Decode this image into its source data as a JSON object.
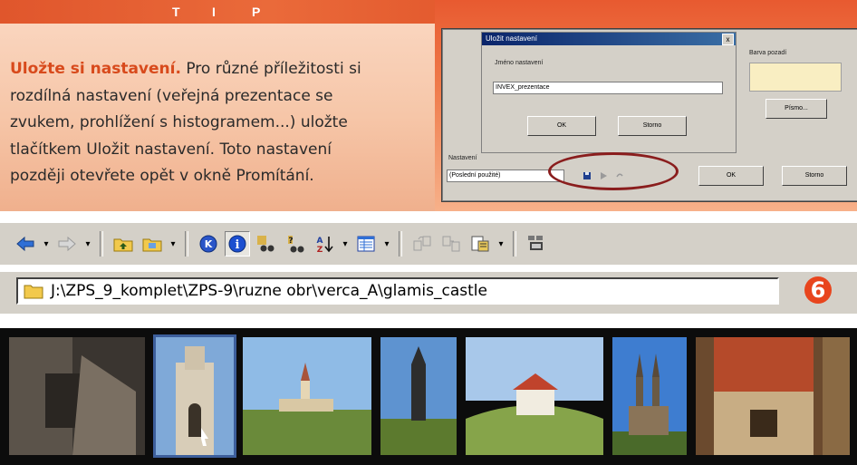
{
  "tip": {
    "heading": [
      "T",
      "I",
      "P"
    ],
    "lead": "Uložte si nastavení.",
    "body_lines": [
      " Pro různé příležitosti si",
      "rozdílná nastavení (veřejná prezentace se",
      "zvukem, prohlížení s histogramem...) uložte",
      "tlačítkem Uložit nastavení. Toto nastavení",
      "později otevřete opět v okně Promítání."
    ]
  },
  "dialog": {
    "title": "Uložit nastavení",
    "close": "x",
    "name_label": "Jméno nastavení",
    "name_value": "INVEX_prezentace",
    "ok": "OK",
    "cancel": "Storno",
    "right_label": "Barva pozadí",
    "font_button": "Písmo...",
    "bottom_label": "Nastavení",
    "bottom_value": "(Poslední použité)",
    "bottom_ok": "OK",
    "bottom_cancel": "Storno"
  },
  "toolbar": {
    "buttons": [
      "back-arrow-icon",
      "forward-arrow-icon",
      "folder-up-icon",
      "folder-browse-icon",
      "k-circle-icon",
      "info-circle-icon",
      "binoculars-icon",
      "find-key-icon",
      "sort-az-icon",
      "view-details-icon",
      "copy-to-icon",
      "move-to-icon",
      "properties-icon",
      "slideshow-icon"
    ]
  },
  "address": {
    "path": "J:\\ZPS_9_komplet\\ZPS-9\\ruzne obr\\verca_A\\glamis_castle"
  },
  "badge": "6",
  "thumbnails": [
    {
      "name": "old-stone-wall"
    },
    {
      "name": "castle-tower-selected"
    },
    {
      "name": "church-landscape"
    },
    {
      "name": "monument-tower"
    },
    {
      "name": "chapel-on-hill"
    },
    {
      "name": "cathedral-spires"
    },
    {
      "name": "rooftop-view"
    }
  ],
  "colors": {
    "accent": "#e0562c",
    "tip_bg": "#f6c6a8",
    "badge": "#e8451d",
    "toolbar": "#d4d0c8"
  }
}
